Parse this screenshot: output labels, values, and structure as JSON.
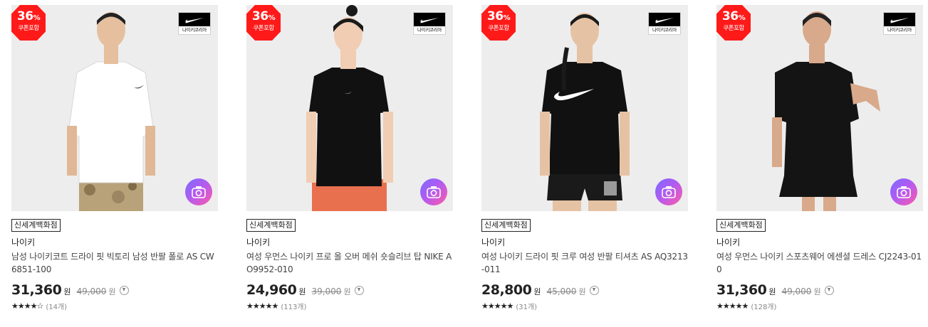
{
  "products": [
    {
      "discount_pct": "36",
      "discount_pct_sign": "%",
      "discount_sub": "쿠폰포함",
      "brand_logo_text": "나이키코리아",
      "store": "신세계백화점",
      "brand": "나이키",
      "title": "남성 나이키코트 드라이 핏 빅토리 남성 반팔 폴로 AS CW6851-100",
      "price": "31,360",
      "price_unit": "원",
      "original_price": "49,000",
      "original_unit": "원",
      "stars": "★★★★☆",
      "reviews": "(14개)",
      "shirt_color": "#ffffff",
      "image_icon": "camera-icon"
    },
    {
      "discount_pct": "36",
      "discount_pct_sign": "%",
      "discount_sub": "쿠폰포함",
      "brand_logo_text": "나이키코리아",
      "store": "신세계백화점",
      "brand": "나이키",
      "title": "여성 우먼스 나이키 프로 올 오버 메쉬 숏슬리브 탑 NIKE AO9952-010",
      "price": "24,960",
      "price_unit": "원",
      "original_price": "39,000",
      "original_unit": "원",
      "stars": "★★★★★",
      "reviews": "(113개)",
      "shirt_color": "#111111",
      "image_icon": "camera-icon"
    },
    {
      "discount_pct": "36",
      "discount_pct_sign": "%",
      "discount_sub": "쿠폰포함",
      "brand_logo_text": "나이키코리아",
      "store": "신세계백화점",
      "brand": "나이키",
      "title": "여성 나이키 드라이 핏 크루 여성 반팔 티셔츠 AS AQ3213-011",
      "price": "28,800",
      "price_unit": "원",
      "original_price": "45,000",
      "original_unit": "원",
      "stars": "★★★★★",
      "reviews": "(31개)",
      "shirt_color": "#111111",
      "image_icon": "camera-icon"
    },
    {
      "discount_pct": "36",
      "discount_pct_sign": "%",
      "discount_sub": "쿠폰포함",
      "brand_logo_text": "나이키코리아",
      "store": "신세계백화점",
      "brand": "나이키",
      "title": "여성 우먼스 나이키 스포츠웨어 에센셜 드레스 CJ2243-010",
      "price": "31,360",
      "price_unit": "원",
      "original_price": "49,000",
      "original_unit": "원",
      "stars": "★★★★★",
      "reviews": "(128개)",
      "shirt_color": "#111111",
      "image_icon": "camera-icon"
    }
  ]
}
